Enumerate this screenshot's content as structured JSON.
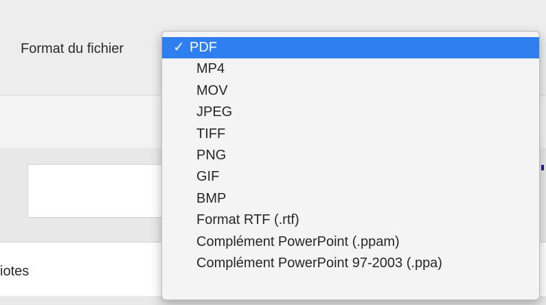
{
  "format_label": "Format du fichier",
  "notes_label": "iotes",
  "dropdown": {
    "check_glyph": "✓",
    "selected": "PDF",
    "options": [
      "PDF",
      "MP4",
      "MOV",
      "JPEG",
      "TIFF",
      "PNG",
      "GIF",
      "BMP",
      "Format RTF (.rtf)",
      "Complément PowerPoint (.ppam)",
      "Complément PowerPoint 97-2003 (.ppa)"
    ]
  },
  "colors": {
    "selection": "#2f7ff0",
    "selection_text": "#ffffff",
    "menu_background": "#f4f4f4",
    "window_background": "#ececec"
  }
}
